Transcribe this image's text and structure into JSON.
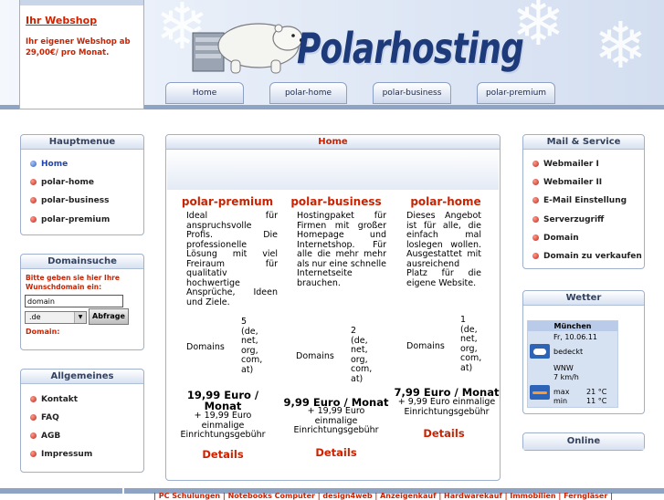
{
  "promo": {
    "title": "Ihr Webshop",
    "text": "Ihr eigener Webshop ab 29,00€/ pro Monat."
  },
  "logo": {
    "text": "Polarhosting"
  },
  "top_tabs": [
    "Home",
    "polar-home",
    "polar-business",
    "polar-premium"
  ],
  "hauptmenue": {
    "title": "Hauptmenue",
    "items": [
      "Home",
      "polar-home",
      "polar-business",
      "polar-premium"
    ]
  },
  "domainsuche": {
    "title": "Domainsuche",
    "prompt": "Bitte geben sie hier Ihre Wunschdomain ein:",
    "input_value": "domain",
    "tld_value": ".de",
    "button_label": "Abfrage",
    "result_label": "Domain:"
  },
  "allgemeines": {
    "title": "Allgemeines",
    "items": [
      "Kontakt",
      "FAQ",
      "AGB",
      "Impressum"
    ]
  },
  "main": {
    "title": "Home",
    "columns": [
      {
        "title": "polar-premium",
        "description": "Ideal für anspruchsvolle Profis. Die professionelle Lösung mit viel Freiraum für qualitativ hochwertige Ansprüche, Ideen und Ziele.",
        "domains_label": "Domains",
        "domains_count": "5",
        "domains_tlds": "(de, net, org, com, at)",
        "price": "19,99 Euro / Monat",
        "setup_fee": "+ 19,99 Euro einmalige Einrichtungsgebühr",
        "details_label": "Details"
      },
      {
        "title": "polar-business",
        "description": "Hostingpaket für Firmen mit großer Homepage und Internetshop. Für alle die mehr mehr als nur eine schnelle Internetseite brauchen.",
        "domains_label": "Domains",
        "domains_count": "2",
        "domains_tlds": "(de, net, org, com, at)",
        "price": "9,99 Euro / Monat",
        "setup_fee": "+ 19,99 Euro einmalige Einrichtungsgebühr",
        "details_label": "Details"
      },
      {
        "title": "polar-home",
        "description": "Dieses Angebot ist für alle, die einfach mal loslegen wollen. Ausgestattet mit ausreichend Platz für die eigene Website.",
        "domains_label": "Domains",
        "domains_count": "1",
        "domains_tlds": "(de, net, org, com, at)",
        "price": "7,99 Euro / Monat",
        "setup_fee": "+ 9,99 Euro einmalige Einrichtungsgebühr",
        "details_label": "Details"
      }
    ]
  },
  "mail_service": {
    "title": "Mail & Service",
    "items": [
      "Webmailer I",
      "Webmailer II",
      "E-Mail Einstellung",
      "Serverzugriff",
      "Domain",
      "Domain zu verkaufen"
    ]
  },
  "wetter": {
    "title": "Wetter",
    "city": "München",
    "date": "Fr, 10.06.11",
    "condition": "bedeckt",
    "wind_direction": "WNW",
    "wind_speed": "7 km/h",
    "max_label": "max",
    "max_value": "21 °C",
    "min_label": "min",
    "min_value": "11 °C"
  },
  "online": {
    "title": "Online"
  },
  "footer": {
    "links": "| PC Schulungen | Notebooks Computer | design4web | Anzeigenkauf | Hardwarekauf | Immobilien | Ferngläser |"
  },
  "colors": {
    "accent_red": "#cc2200",
    "nav_blue": "#2244aa",
    "frame_blue": "#8ea4c4"
  }
}
